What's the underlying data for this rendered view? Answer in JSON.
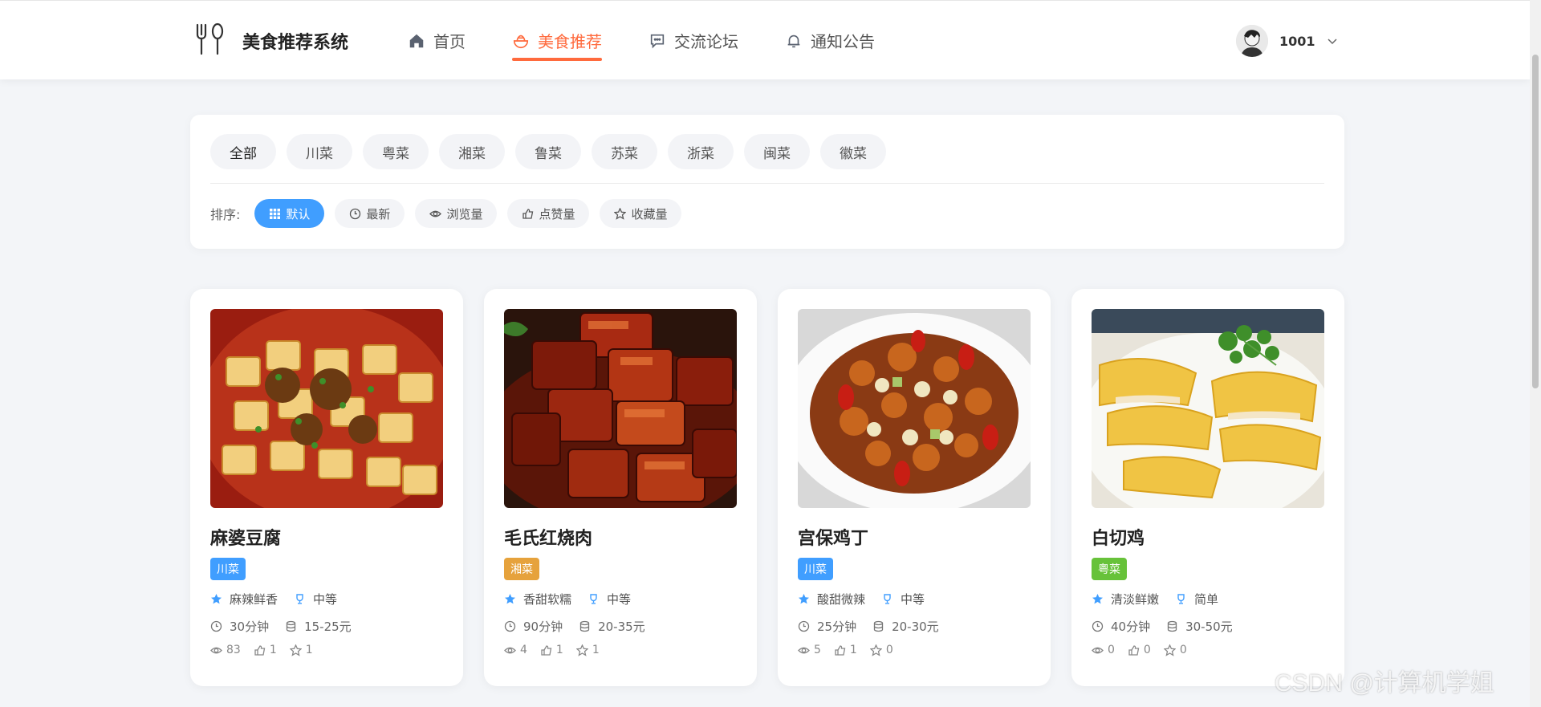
{
  "header": {
    "logo_text": "美食推荐系统",
    "logo_icon": "fork-spoon-icon",
    "nav": [
      {
        "label": "首页",
        "icon": "home-icon"
      },
      {
        "label": "美食推荐",
        "icon": "food-bowl-icon",
        "active": true
      },
      {
        "label": "交流论坛",
        "icon": "chat-icon"
      },
      {
        "label": "通知公告",
        "icon": "bell-icon"
      }
    ],
    "user": {
      "name": "1001",
      "icon": "chevron-down-icon"
    },
    "accent": "#ff6a3d"
  },
  "filter": {
    "categories": [
      "全部",
      "川菜",
      "粤菜",
      "湘菜",
      "鲁菜",
      "苏菜",
      "浙菜",
      "闽菜",
      "徽菜"
    ],
    "active_category": "全部",
    "sort_label": "排序:",
    "sort_options": [
      {
        "label": "默认",
        "icon": "grid-icon",
        "active": true
      },
      {
        "label": "最新",
        "icon": "clock-icon"
      },
      {
        "label": "浏览量",
        "icon": "eye-icon"
      },
      {
        "label": "点赞量",
        "icon": "thumb-up-icon"
      },
      {
        "label": "收藏量",
        "icon": "star-icon"
      }
    ],
    "active_color": "#409eff"
  },
  "dishes": [
    {
      "name": "麻婆豆腐",
      "tag": "川菜",
      "tag_color": "#409eff",
      "flavor": "麻辣鲜香",
      "difficulty": "中等",
      "time": "30分钟",
      "price": "15-25元",
      "views": "83",
      "likes": "1",
      "favorites": "1"
    },
    {
      "name": "毛氏红烧肉",
      "tag": "湘菜",
      "tag_color": "#e6a23c",
      "flavor": "香甜软糯",
      "difficulty": "中等",
      "time": "90分钟",
      "price": "20-35元",
      "views": "4",
      "likes": "1",
      "favorites": "1"
    },
    {
      "name": "宫保鸡丁",
      "tag": "川菜",
      "tag_color": "#409eff",
      "flavor": "酸甜微辣",
      "difficulty": "中等",
      "time": "25分钟",
      "price": "20-30元",
      "views": "5",
      "likes": "1",
      "favorites": "0"
    },
    {
      "name": "白切鸡",
      "tag": "粤菜",
      "tag_color": "#67c23a",
      "flavor": "清淡鲜嫩",
      "difficulty": "简单",
      "time": "40分钟",
      "price": "30-50元",
      "views": "0",
      "likes": "0",
      "favorites": "0"
    }
  ],
  "watermark": "CSDN @计算机学姐"
}
